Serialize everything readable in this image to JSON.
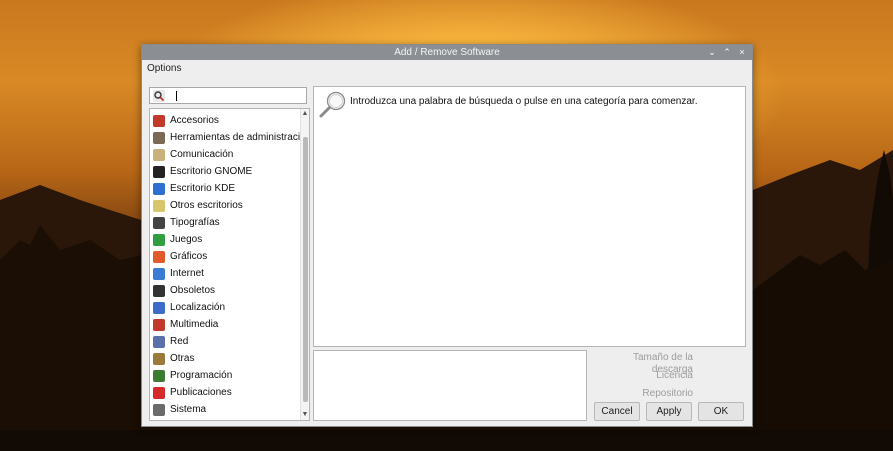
{
  "window": {
    "title": "Add / Remove Software",
    "controls": {
      "minimize": "⌄",
      "maximize": "⌃",
      "close": "×"
    }
  },
  "menu": {
    "options_label": "Options"
  },
  "search": {
    "value": "",
    "placeholder": ""
  },
  "categories": {
    "items": [
      {
        "label": "Accesorios",
        "icon": "accessories-icon",
        "color": "#c0392b"
      },
      {
        "label": "Herramientas de administració",
        "icon": "admin-tools-icon",
        "color": "#7a6a55"
      },
      {
        "label": "Comunicación",
        "icon": "communication-icon",
        "color": "#c8b27a"
      },
      {
        "label": "Escritorio GNOME",
        "icon": "gnome-icon",
        "color": "#222222"
      },
      {
        "label": "Escritorio KDE",
        "icon": "kde-icon",
        "color": "#2f6fd1"
      },
      {
        "label": "Otros escritorios",
        "icon": "other-desktops-icon",
        "color": "#d7c76a"
      },
      {
        "label": "Tipografías",
        "icon": "fonts-icon",
        "color": "#444444"
      },
      {
        "label": "Juegos",
        "icon": "games-icon",
        "color": "#2e9e3e"
      },
      {
        "label": "Gráficos",
        "icon": "graphics-icon",
        "color": "#e05a2b"
      },
      {
        "label": "Internet",
        "icon": "internet-icon",
        "color": "#3a7bd5"
      },
      {
        "label": "Obsoletos",
        "icon": "obsolete-icon",
        "color": "#333333"
      },
      {
        "label": "Localización",
        "icon": "localization-icon",
        "color": "#3b6cc7"
      },
      {
        "label": "Multimedia",
        "icon": "multimedia-icon",
        "color": "#c0392b"
      },
      {
        "label": "Red",
        "icon": "network-icon",
        "color": "#5b6fa8"
      },
      {
        "label": "Otras",
        "icon": "other-icon",
        "color": "#9c7a3c"
      },
      {
        "label": "Programación",
        "icon": "programming-icon",
        "color": "#3e7a33"
      },
      {
        "label": "Publicaciones",
        "icon": "publishing-icon",
        "color": "#d42a2a"
      },
      {
        "label": "Sistema",
        "icon": "system-icon",
        "color": "#6b6b6b"
      }
    ]
  },
  "results": {
    "hint": "Introduzca una palabra de búsqueda o pulse en una categoría para comenzar."
  },
  "details": {
    "download_size_label": "Tamaño de la descarga",
    "license_label": "Licencia",
    "repository_label": "Repositorio"
  },
  "buttons": {
    "cancel": "Cancel",
    "apply": "Apply",
    "ok": "OK"
  }
}
